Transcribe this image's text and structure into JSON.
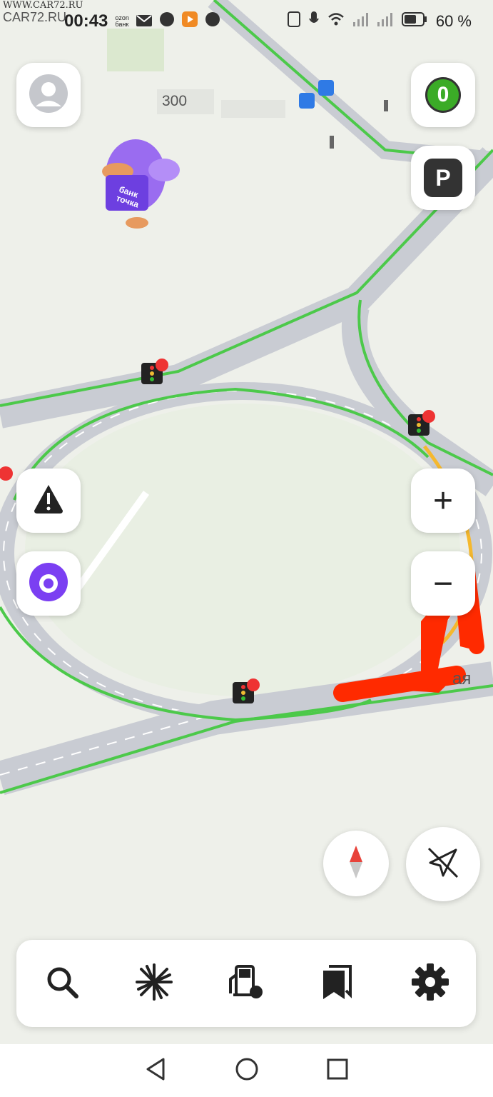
{
  "status_bar": {
    "time": "00:43",
    "ozon_label_top": "ozon",
    "ozon_label_bottom": "банк",
    "battery": "60 %"
  },
  "watermark": {
    "line1": "WWW.CAR72.RU",
    "line2": "CAR72.RU"
  },
  "map": {
    "house_number": "300",
    "street_fragment": "ая",
    "promo_label": "банк точка"
  },
  "buttons": {
    "score_value": "0",
    "parking_label": "P",
    "zoom_in": "+",
    "zoom_out": "−"
  },
  "bottom_bar": {
    "items": [
      "search-icon",
      "hot-places-icon",
      "gas-station-icon",
      "bookmarks-icon",
      "settings-icon"
    ]
  },
  "colors": {
    "road": "#c8ccd4",
    "traffic_green": "#4cc94a",
    "traffic_yellow": "#f5b82e",
    "annotation_red": "#ff2a00",
    "alice_purple": "#7b3ff2"
  }
}
